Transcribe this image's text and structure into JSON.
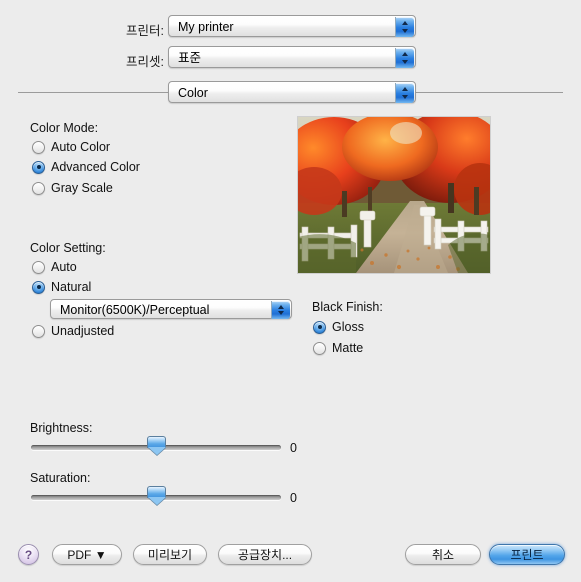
{
  "dialog": {
    "printer_label": "프린터:",
    "printer_value": "My printer",
    "preset_label": "프리셋:",
    "preset_value": "표준",
    "pane_value": "Color"
  },
  "color_mode": {
    "title": "Color Mode:",
    "options": [
      {
        "label": "Auto Color",
        "selected": false
      },
      {
        "label": "Advanced Color",
        "selected": true
      },
      {
        "label": "Gray Scale",
        "selected": false
      }
    ]
  },
  "color_setting": {
    "title": "Color Setting:",
    "options": [
      {
        "label": "Auto",
        "selected": false
      },
      {
        "label": "Natural",
        "selected": true
      },
      {
        "label": "Unadjusted",
        "selected": false
      }
    ],
    "profile_value": "Monitor(6500K)/Perceptual"
  },
  "black_finish": {
    "title": "Black Finish:",
    "options": [
      {
        "label": "Gloss",
        "selected": true
      },
      {
        "label": "Matte",
        "selected": false
      }
    ]
  },
  "sliders": {
    "brightness_label": "Brightness:",
    "brightness_value": "0",
    "saturation_label": "Saturation:",
    "saturation_value": "0"
  },
  "buttons": {
    "help": "?",
    "pdf": "PDF ▼",
    "preview": "미리보기",
    "supply": "공급장치...",
    "cancel": "취소",
    "print": "프린트"
  },
  "colors": {
    "background": "#ececec",
    "accent_blue": "#2a7fe0",
    "help_purple": "#c3b2d6"
  }
}
